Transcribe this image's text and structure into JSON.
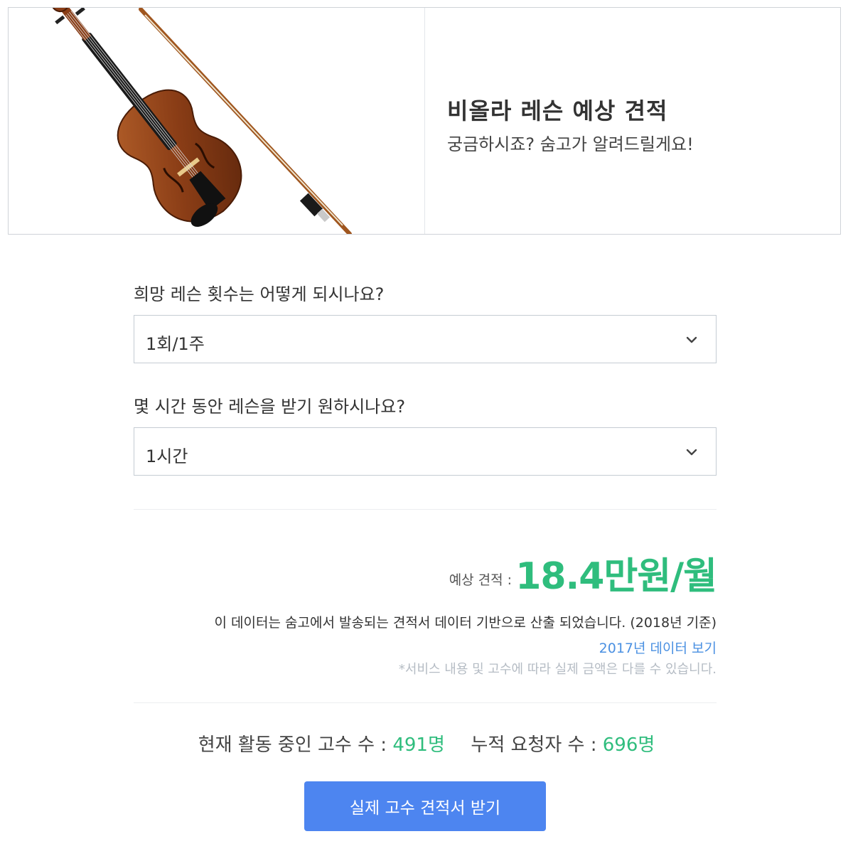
{
  "hero": {
    "title": "비올라 레슨 예상 견적",
    "subtitle": "궁금하시죠? 숨고가 알려드릴게요!",
    "image": "viola-with-bow"
  },
  "form": {
    "q1": {
      "label": "희망 레슨 횟수는 어떻게 되시나요?",
      "value": "1회/1주"
    },
    "q2": {
      "label": "몇 시간 동안 레슨을 받기 원하시나요?",
      "value": "1시간"
    }
  },
  "estimate": {
    "label": "예상 견적 :",
    "value": "18.4만원/월",
    "note": "이 데이터는 숨고에서 발송되는 견적서 데이터 기반으로 산출 되었습니다. (2018년 기준)",
    "link_2017": "2017년 데이터 보기",
    "disclaimer": "*서비스 내용 및 고수에 따라 실제 금액은 다를 수 있습니다."
  },
  "stats": {
    "active_label": "현재 활동 중인 고수 수 :",
    "active_value": "491명",
    "requests_label": "누적 요청자 수 :",
    "requests_value": "696명"
  },
  "cta": {
    "label": "실제 고수 견적서 받기"
  },
  "colors": {
    "accent_green": "#2fbd7d",
    "link_blue": "#4a90e2",
    "button_blue": "#4d85f0"
  }
}
